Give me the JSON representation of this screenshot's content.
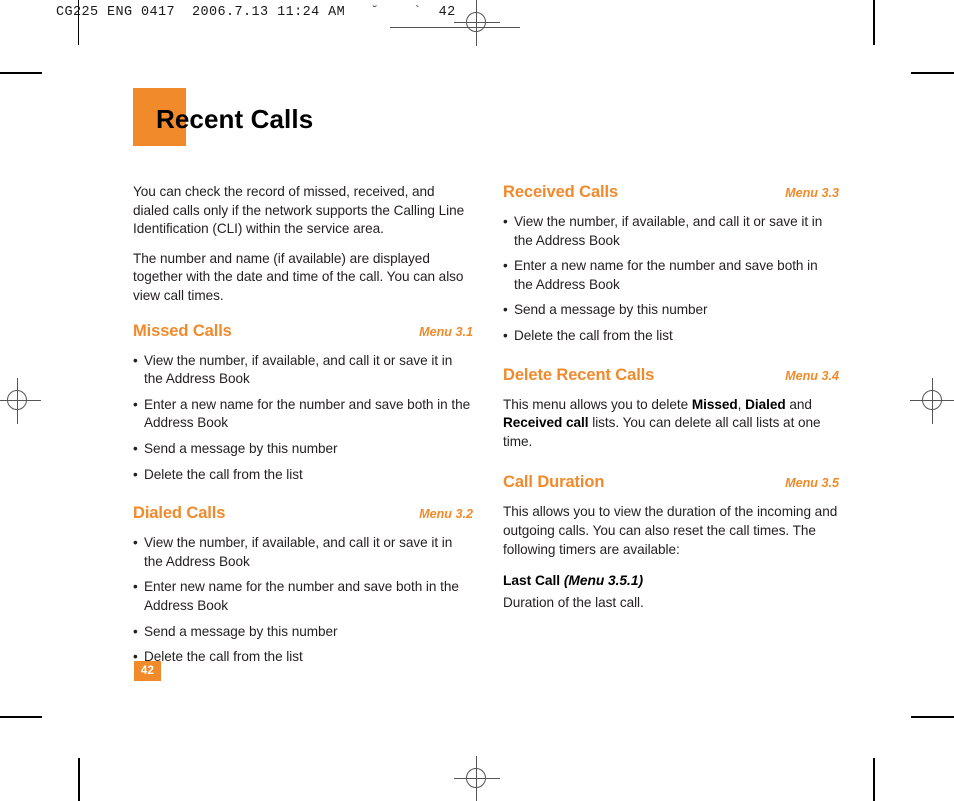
{
  "running_head": {
    "doc_code": "CG225 ENG 0417",
    "date": "2006.7.13",
    "time": "11:24 AM",
    "mark_a": "˘",
    "mark_b": "`",
    "page": "42"
  },
  "page_title": "Recent Calls",
  "folio": "42",
  "colors": {
    "accent_orange": "#F08A2B",
    "body_text": "#231f20",
    "title_text": "#000000",
    "folio_text": "#ffffff"
  },
  "left_column": {
    "intro_paragraphs": [
      "You can check the record of missed, received, and dialed calls only if the network supports the Calling Line Identification (CLI) within the service area.",
      "The number and name (if available) are displayed together with the date and time of the call. You can also view call times."
    ],
    "sections": [
      {
        "title": "Missed Calls",
        "menu": "Menu 3.1",
        "bullets": [
          "View the number, if available, and call it or save it in the Address Book",
          "Enter a new name for the number and save both in the Address Book",
          "Send a message by this number",
          "Delete the call from the list"
        ]
      },
      {
        "title": "Dialed Calls",
        "menu": "Menu 3.2",
        "bullets": [
          "View the number, if available, and call it or save it in the Address Book",
          "Enter new name for the number and save both in the Address Book",
          "Send a message by this number",
          "Delete the call from the list"
        ]
      }
    ]
  },
  "right_column": {
    "sections": [
      {
        "title": "Received Calls",
        "menu": "Menu 3.3",
        "bullets": [
          "View the number, if available, and call it or save it in the Address Book",
          "Enter a new name for the number and save both in the Address Book",
          "Send a message by this number",
          "Delete the call from the list"
        ]
      },
      {
        "title": "Delete Recent Calls",
        "menu": "Menu 3.4",
        "paragraph": {
          "part1": "This menu allows you to delete ",
          "bold1": "Missed",
          "part2": ", ",
          "bold2": "Dialed",
          "part3": " and ",
          "bold3": "Received call",
          "part4": " lists. You can delete all call lists at one time."
        }
      },
      {
        "title": "Call Duration",
        "menu": "Menu 3.5",
        "paragraph": "This allows you to view the duration of the incoming and outgoing calls. You can also reset the call times. The following timers are available:",
        "subsection": {
          "name": "Last Call",
          "menu": "(Menu 3.5.1)",
          "text": "Duration of the last call."
        }
      }
    ]
  }
}
